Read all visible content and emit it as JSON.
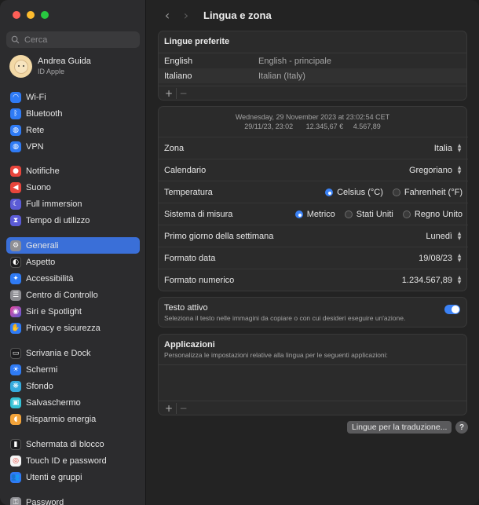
{
  "window": {
    "title": "Lingua e zona"
  },
  "sidebar": {
    "search_placeholder": "Cerca",
    "account": {
      "name": "Andrea Guida",
      "subtitle": "ID Apple"
    },
    "items": [
      {
        "label": "Wi-Fi",
        "icon": "wifi-icon",
        "color": "#2f7bf5"
      },
      {
        "label": "Bluetooth",
        "icon": "bluetooth-icon",
        "color": "#2f7bf5"
      },
      {
        "label": "Rete",
        "icon": "globe-icon",
        "color": "#2f7bf5"
      },
      {
        "label": "VPN",
        "icon": "vpn-globe-icon",
        "color": "#2f7bf5"
      },
      {
        "label": "Notifiche",
        "icon": "bell-icon",
        "color": "#e8453c"
      },
      {
        "label": "Suono",
        "icon": "speaker-icon",
        "color": "#e8453c"
      },
      {
        "label": "Full immersion",
        "icon": "moon-icon",
        "color": "#5b5bd6"
      },
      {
        "label": "Tempo di utilizzo",
        "icon": "hourglass-icon",
        "color": "#5b5bd6"
      },
      {
        "label": "Generali",
        "icon": "gear-icon",
        "color": "#8e8e93"
      },
      {
        "label": "Aspetto",
        "icon": "appearance-icon",
        "color": "#1c1c1e"
      },
      {
        "label": "Accessibilità",
        "icon": "accessibility-icon",
        "color": "#2f7bf5"
      },
      {
        "label": "Centro di Controllo",
        "icon": "control-center-icon",
        "color": "#8e8e93"
      },
      {
        "label": "Siri e Spotlight",
        "icon": "siri-icon",
        "color": "#b44ad6"
      },
      {
        "label": "Privacy e sicurezza",
        "icon": "hand-icon",
        "color": "#2f7bf5"
      },
      {
        "label": "Scrivania e Dock",
        "icon": "dock-icon",
        "color": "#1c1c1e"
      },
      {
        "label": "Schermi",
        "icon": "display-icon",
        "color": "#2f7bf5"
      },
      {
        "label": "Sfondo",
        "icon": "wallpaper-icon",
        "color": "#35aadc"
      },
      {
        "label": "Salvaschermo",
        "icon": "screensaver-icon",
        "color": "#35c2d6"
      },
      {
        "label": "Risparmio energia",
        "icon": "lightbulb-icon",
        "color": "#f2a33a"
      },
      {
        "label": "Schermata di blocco",
        "icon": "lock-screen-icon",
        "color": "#1c1c1e"
      },
      {
        "label": "Touch ID e password",
        "icon": "fingerprint-icon",
        "color": "#ffffff"
      },
      {
        "label": "Utenti e gruppi",
        "icon": "users-icon",
        "color": "#2f7bf5"
      },
      {
        "label": "Password",
        "icon": "key-icon",
        "color": "#8e8e93"
      }
    ],
    "active_item": "Generali"
  },
  "languages": {
    "title": "Lingue preferite",
    "rows": [
      {
        "name": "English",
        "detail": "English - principale"
      },
      {
        "name": "Italiano",
        "detail": "Italian (Italy)"
      }
    ],
    "add_label": "+",
    "remove_label": "−"
  },
  "preview": {
    "line1": "Wednesday, 29 November 2023 at 23:02:54 CET",
    "line2_date": "29/11/23, 23:02",
    "line2_num1": "12.345,67 €",
    "line2_num2": "4.567,89"
  },
  "settings": {
    "zona": {
      "label": "Zona",
      "value": "Italia"
    },
    "calendario": {
      "label": "Calendario",
      "value": "Gregoriano"
    },
    "temperatura": {
      "label": "Temperatura",
      "options": [
        "Celsius (°C)",
        "Fahrenheit (°F)"
      ],
      "selected": "Celsius (°C)"
    },
    "misura": {
      "label": "Sistema di misura",
      "options": [
        "Metrico",
        "Stati Uniti",
        "Regno Unito"
      ],
      "selected": "Metrico"
    },
    "primo_giorno": {
      "label": "Primo giorno della settimana",
      "value": "Lunedì"
    },
    "formato_data": {
      "label": "Formato data",
      "value": "19/08/23"
    },
    "formato_numerico": {
      "label": "Formato numerico",
      "value": "1.234.567,89"
    }
  },
  "testo_attivo": {
    "title": "Testo attivo",
    "description": "Seleziona il testo nelle immagini da copiare o con cui desideri eseguire un'azione.",
    "enabled": true
  },
  "applicazioni": {
    "title": "Applicazioni",
    "description": "Personalizza le impostazioni relative alla lingua per le seguenti applicazioni:",
    "add_label": "+",
    "remove_label": "−"
  },
  "buttons": {
    "translate": "Lingue per la traduzione...",
    "help": "?"
  },
  "colors": {
    "accent": "#3b82f6",
    "sidebar_selected": "#3a6fd8"
  }
}
